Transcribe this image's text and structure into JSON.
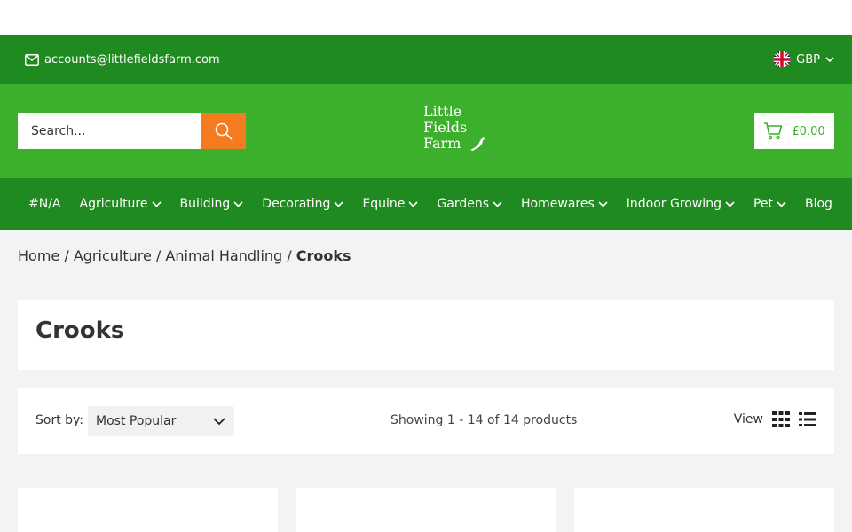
{
  "topbar": {
    "email": "accounts@littlefieldsfarm.com",
    "currency": "GBP"
  },
  "header": {
    "search_placeholder": "Search...",
    "logo_lines": [
      "Little",
      "Fields",
      "Farm"
    ],
    "cart_total": "£0.00"
  },
  "nav": {
    "items": [
      {
        "label": "#N/A",
        "dropdown": false
      },
      {
        "label": "Agriculture",
        "dropdown": true
      },
      {
        "label": "Building",
        "dropdown": true
      },
      {
        "label": "Decorating",
        "dropdown": true
      },
      {
        "label": "Equine",
        "dropdown": true
      },
      {
        "label": "Gardens",
        "dropdown": true
      },
      {
        "label": "Homewares",
        "dropdown": true
      },
      {
        "label": "Indoor Growing",
        "dropdown": true
      },
      {
        "label": "Pet",
        "dropdown": true
      },
      {
        "label": "Blog",
        "dropdown": false
      }
    ]
  },
  "breadcrumb": {
    "items": [
      "Home",
      "Agriculture",
      "Animal Handling"
    ],
    "current": "Crooks",
    "separator": "/"
  },
  "page": {
    "title": "Crooks"
  },
  "toolbar": {
    "sort_label": "Sort by:",
    "sort_value": "Most Popular",
    "showing": "Showing 1 - 14 of 14 products",
    "view_label": "View"
  },
  "colors": {
    "dark_green": "#1f8a1f",
    "green": "#3cb02c",
    "orange": "#f47b20"
  }
}
